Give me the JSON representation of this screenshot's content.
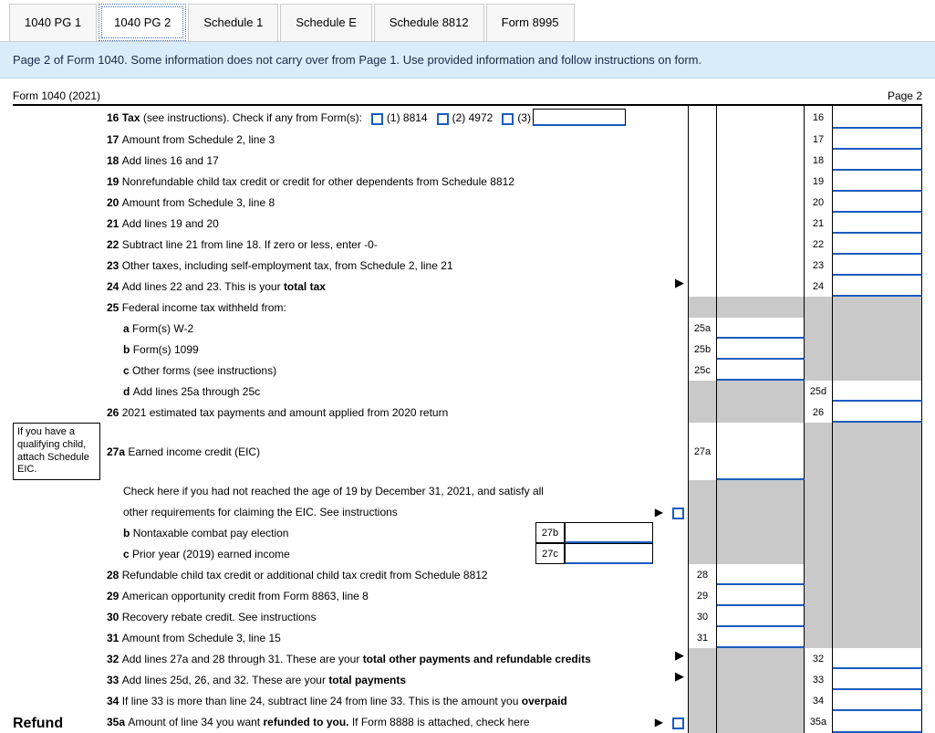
{
  "tabs": [
    "1040 PG 1",
    "1040 PG 2",
    "Schedule 1",
    "Schedule E",
    "Schedule 8812",
    "Form 8995"
  ],
  "active_tab": 1,
  "banner": "Page 2 of Form 1040. Some information does not carry over from Page 1. Use provided information and follow instructions on form.",
  "form_label": "Form 1040 (2021)",
  "page_label": "Page 2",
  "sidebar_eic": "If you have a qualifying child, attach Schedule EIC.",
  "refund_heading": "Refund",
  "lines": {
    "l16": {
      "no": "16",
      "text": "Tax (see instructions). Check if any from Form(s):",
      "c1": "(1) 8814",
      "c2": "(2) 4972",
      "c3": "(3)",
      "box": "16"
    },
    "l17": {
      "no": "17",
      "text": "Amount from Schedule 2, line 3",
      "box": "17"
    },
    "l18": {
      "no": "18",
      "text": "Add lines 16 and 17",
      "box": "18"
    },
    "l19": {
      "no": "19",
      "text": "Nonrefundable child tax credit or credit for other dependents from Schedule 8812",
      "box": "19"
    },
    "l20": {
      "no": "20",
      "text": "Amount from Schedule 3, line 8",
      "box": "20"
    },
    "l21": {
      "no": "21",
      "text": "Add lines 19 and 20",
      "box": "21"
    },
    "l22": {
      "no": "22",
      "text": "Subtract line 21 from line 18. If zero or less, enter -0-",
      "box": "22"
    },
    "l23": {
      "no": "23",
      "text": "Other taxes, including self-employment tax, from Schedule 2, line 21",
      "box": "23"
    },
    "l24": {
      "no": "24",
      "text_a": "Add lines 22 and 23. This is your",
      "text_b": "total tax",
      "box": "24"
    },
    "l25": {
      "no": "25",
      "text": "Federal income tax withheld from:"
    },
    "l25a": {
      "lbl": "a",
      "text": "Form(s) W-2",
      "box": "25a"
    },
    "l25b": {
      "lbl": "b",
      "text": "Form(s) 1099",
      "box": "25b"
    },
    "l25c": {
      "lbl": "c",
      "text": "Other forms (see instructions)",
      "box": "25c"
    },
    "l25d": {
      "lbl": "d",
      "text": "Add lines 25a through 25c",
      "box": "25d"
    },
    "l26": {
      "no": "26",
      "text": "2021 estimated tax payments and amount applied from 2020 return",
      "box": "26"
    },
    "l27a": {
      "no": "27a",
      "text": "Earned income credit (EIC)",
      "box": "27a"
    },
    "l27ck": {
      "text": "Check here if you had not reached the age of 19 by December 31, 2021, and satisfy all other requirements for claiming the EIC. See instructions"
    },
    "l27b": {
      "lbl": "b",
      "text": "Nontaxable combat pay election",
      "box": "27b"
    },
    "l27c": {
      "lbl": "c",
      "text": "Prior year (2019) earned income",
      "box": "27c"
    },
    "l28": {
      "no": "28",
      "text": "Refundable child tax credit or additional child tax credit from Schedule 8812",
      "box": "28"
    },
    "l29": {
      "no": "29",
      "text": "American opportunity credit from Form 8863, line 8",
      "box": "29"
    },
    "l30": {
      "no": "30",
      "text": "Recovery rebate credit. See instructions",
      "box": "30"
    },
    "l31": {
      "no": "31",
      "text": "Amount from Schedule 3, line 15",
      "box": "31"
    },
    "l32": {
      "no": "32",
      "text_a": "Add lines 27a and 28 through 31. These are your",
      "text_b": "total other payments and refundable credits",
      "box": "32"
    },
    "l33": {
      "no": "33",
      "text_a": "Add lines 25d, 26, and 32. These are your",
      "text_b": "total payments",
      "box": "33"
    },
    "l34": {
      "no": "34",
      "text_a": "If line 33 is more than line 24, subtract line 24 from line 33. This is the amount you",
      "text_b": "overpaid",
      "box": "34"
    },
    "l35a": {
      "no": "35a",
      "text_a": "Amount of line 34 you want",
      "text_b": "refunded to you.",
      "text_c": "If Form 8888 is attached, check here",
      "box": "35a"
    }
  }
}
